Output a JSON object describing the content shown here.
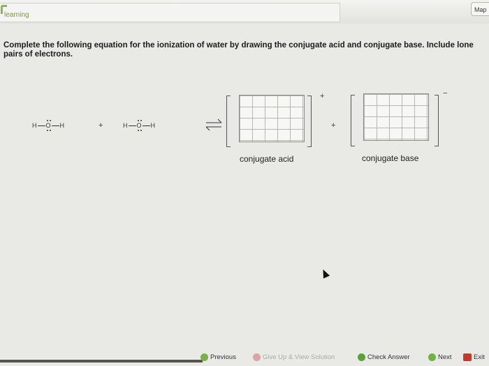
{
  "header": {
    "logo_text": "learning",
    "map_label": "Map"
  },
  "question": {
    "instructions": "Complete the following equation for the ionization of water by drawing the conjugate acid and conjugate base. Include lone pairs of electrons."
  },
  "equation": {
    "reactant_1": {
      "left": "H",
      "center": "O",
      "right": "H"
    },
    "plus_1": "+",
    "reactant_2": {
      "left": "H",
      "center": "O",
      "right": "H"
    },
    "plus_2": "+",
    "acid_charge": "+",
    "base_charge": "−",
    "acid_label": "conjugate acid",
    "base_label": "conjugate base"
  },
  "footer": {
    "previous_label": "Previous",
    "give_up_label": "Give Up & View Solution",
    "check_label": "Check Answer",
    "next_label": "Next",
    "exit_label": "Exit"
  }
}
